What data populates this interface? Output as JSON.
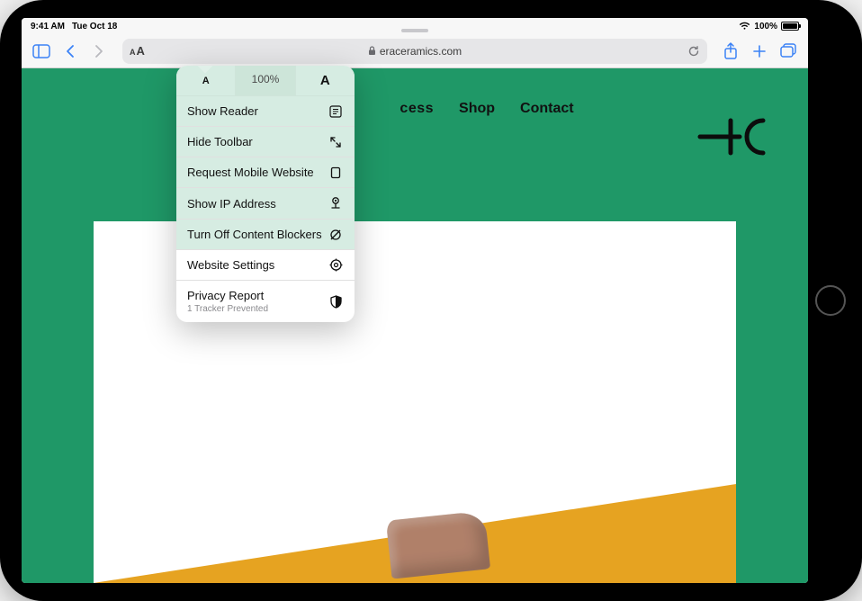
{
  "status": {
    "time": "9:41 AM",
    "date": "Tue Oct 18",
    "battery_pct": "100%"
  },
  "toolbar": {
    "aa_label": "AA",
    "url": "eraceramics.com"
  },
  "popover": {
    "zoom_pct": "100%",
    "items": [
      {
        "label": "Show Reader"
      },
      {
        "label": "Hide Toolbar"
      },
      {
        "label": "Request Mobile Website"
      },
      {
        "label": "Show IP Address"
      },
      {
        "label": "Turn Off Content Blockers"
      }
    ],
    "settings_label": "Website Settings",
    "privacy_label": "Privacy Report",
    "privacy_detail": "1 Tracker Prevented"
  },
  "site": {
    "nav_partial": "cess",
    "nav_shop": "Shop",
    "nav_contact": "Contact"
  }
}
